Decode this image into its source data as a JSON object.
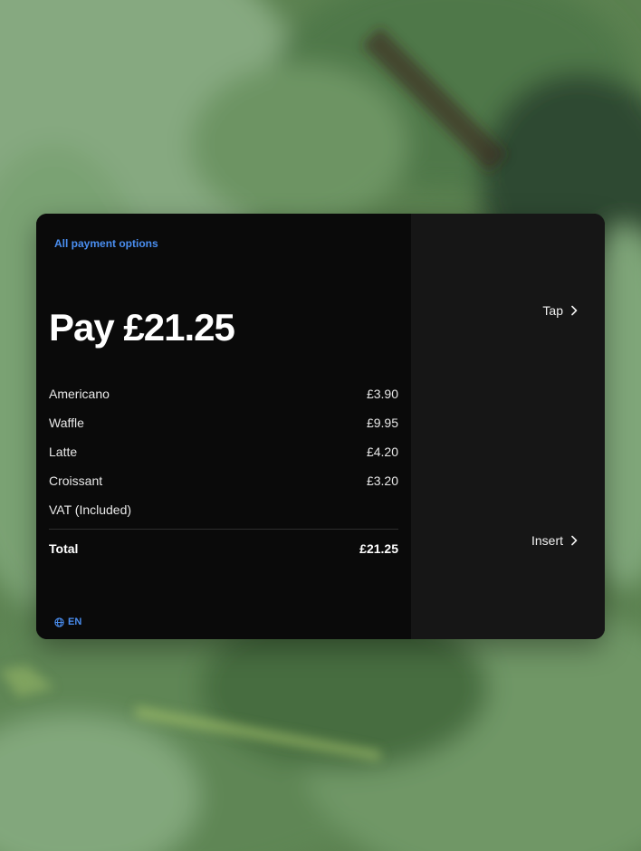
{
  "payment": {
    "all_options_label": "All payment options",
    "title": "Pay £21.25",
    "items": [
      {
        "name": "Americano",
        "price": "£3.90"
      },
      {
        "name": "Waffle",
        "price": "£9.95"
      },
      {
        "name": "Latte",
        "price": "£4.20"
      },
      {
        "name": "Croissant",
        "price": "£3.20"
      },
      {
        "name": "VAT (Included)",
        "price": ""
      }
    ],
    "total_label": "Total",
    "total_value": "£21.25",
    "language": "EN"
  },
  "methods": {
    "tap_label": "Tap",
    "insert_label": "Insert"
  },
  "icons": {
    "language": "globe-icon",
    "tap_arrow": "chevron-right-icon",
    "insert_arrow": "chevron-right-icon"
  },
  "colors": {
    "accent": "#4a8ef0",
    "panel_left": "#0a0a0a",
    "panel_right": "#161616",
    "text_primary": "#ffffff"
  }
}
